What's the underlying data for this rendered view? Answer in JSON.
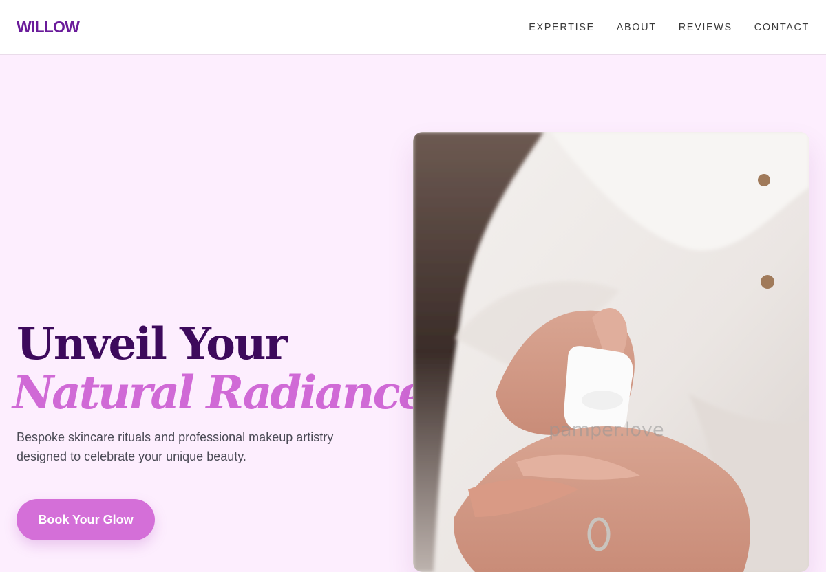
{
  "brand": {
    "logo": "WILLOW"
  },
  "nav": {
    "items": [
      {
        "label": "EXPERTISE"
      },
      {
        "label": "ABOUT"
      },
      {
        "label": "REVIEWS"
      },
      {
        "label": "CONTACT"
      }
    ]
  },
  "hero": {
    "headline_line1": "Unveil Your",
    "headline_line2": "Natural Radiance.",
    "subtext": "Bespoke skincare rituals and professional makeup artistry designed to celebrate your unique beauty.",
    "cta_label": "Book Your Glow",
    "image": {
      "description": "hands pumping lotion from a white bottle, person in white shirt",
      "watermark": "pamper.love"
    }
  },
  "colors": {
    "brand_purple": "#6a1b9a",
    "headline_dark": "#3d0a5c",
    "accent_pink": "#d06ad6",
    "page_bg": "#fdeefe"
  }
}
